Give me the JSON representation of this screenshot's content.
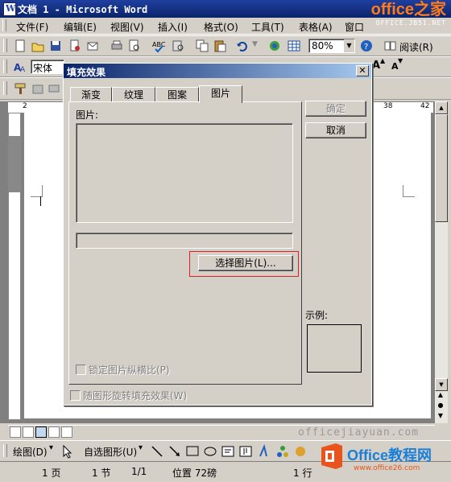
{
  "window": {
    "title": "文档 1 - Microsoft Word",
    "icon_glyph": "W"
  },
  "brand": {
    "line1": "office之家",
    "line2": "OFFICE.JB51.NET"
  },
  "menu": [
    "文件(F)",
    "编辑(E)",
    "视图(V)",
    "插入(I)",
    "格式(O)",
    "工具(T)",
    "表格(A)",
    "窗口"
  ],
  "toolbar": {
    "zoom": "80%",
    "read_label": "阅读(R)",
    "font_name": "宋体"
  },
  "ruler": {
    "marks": [
      "2",
      "38",
      "42"
    ]
  },
  "dialog": {
    "title": "填充效果",
    "tabs": [
      "渐变",
      "纹理",
      "图案",
      "图片"
    ],
    "active_tab": 3,
    "picture_label": "图片:",
    "select_button": "选择图片(L)...",
    "lock_aspect": "锁定图片纵横比(P)",
    "rotate_with_shape": "随图形旋转填充效果(W)",
    "ok": "确定",
    "cancel": "取消",
    "sample_label": "示例:"
  },
  "drawbar": {
    "draw_label": "绘图(D)",
    "autoshape_label": "自选图形(U)"
  },
  "status": {
    "page": "1 页",
    "section": "1 节",
    "pages": "1/1",
    "position": "位置 72磅",
    "line": "1 行"
  },
  "watermark": {
    "text": "officejiayuan.com",
    "logo_text": "Office教程网",
    "logo_url": "www.office26.com"
  },
  "colors": {
    "title_bar": "#0a246a",
    "highlight": "#e02020",
    "brand_orange": "#ff7a1a"
  }
}
